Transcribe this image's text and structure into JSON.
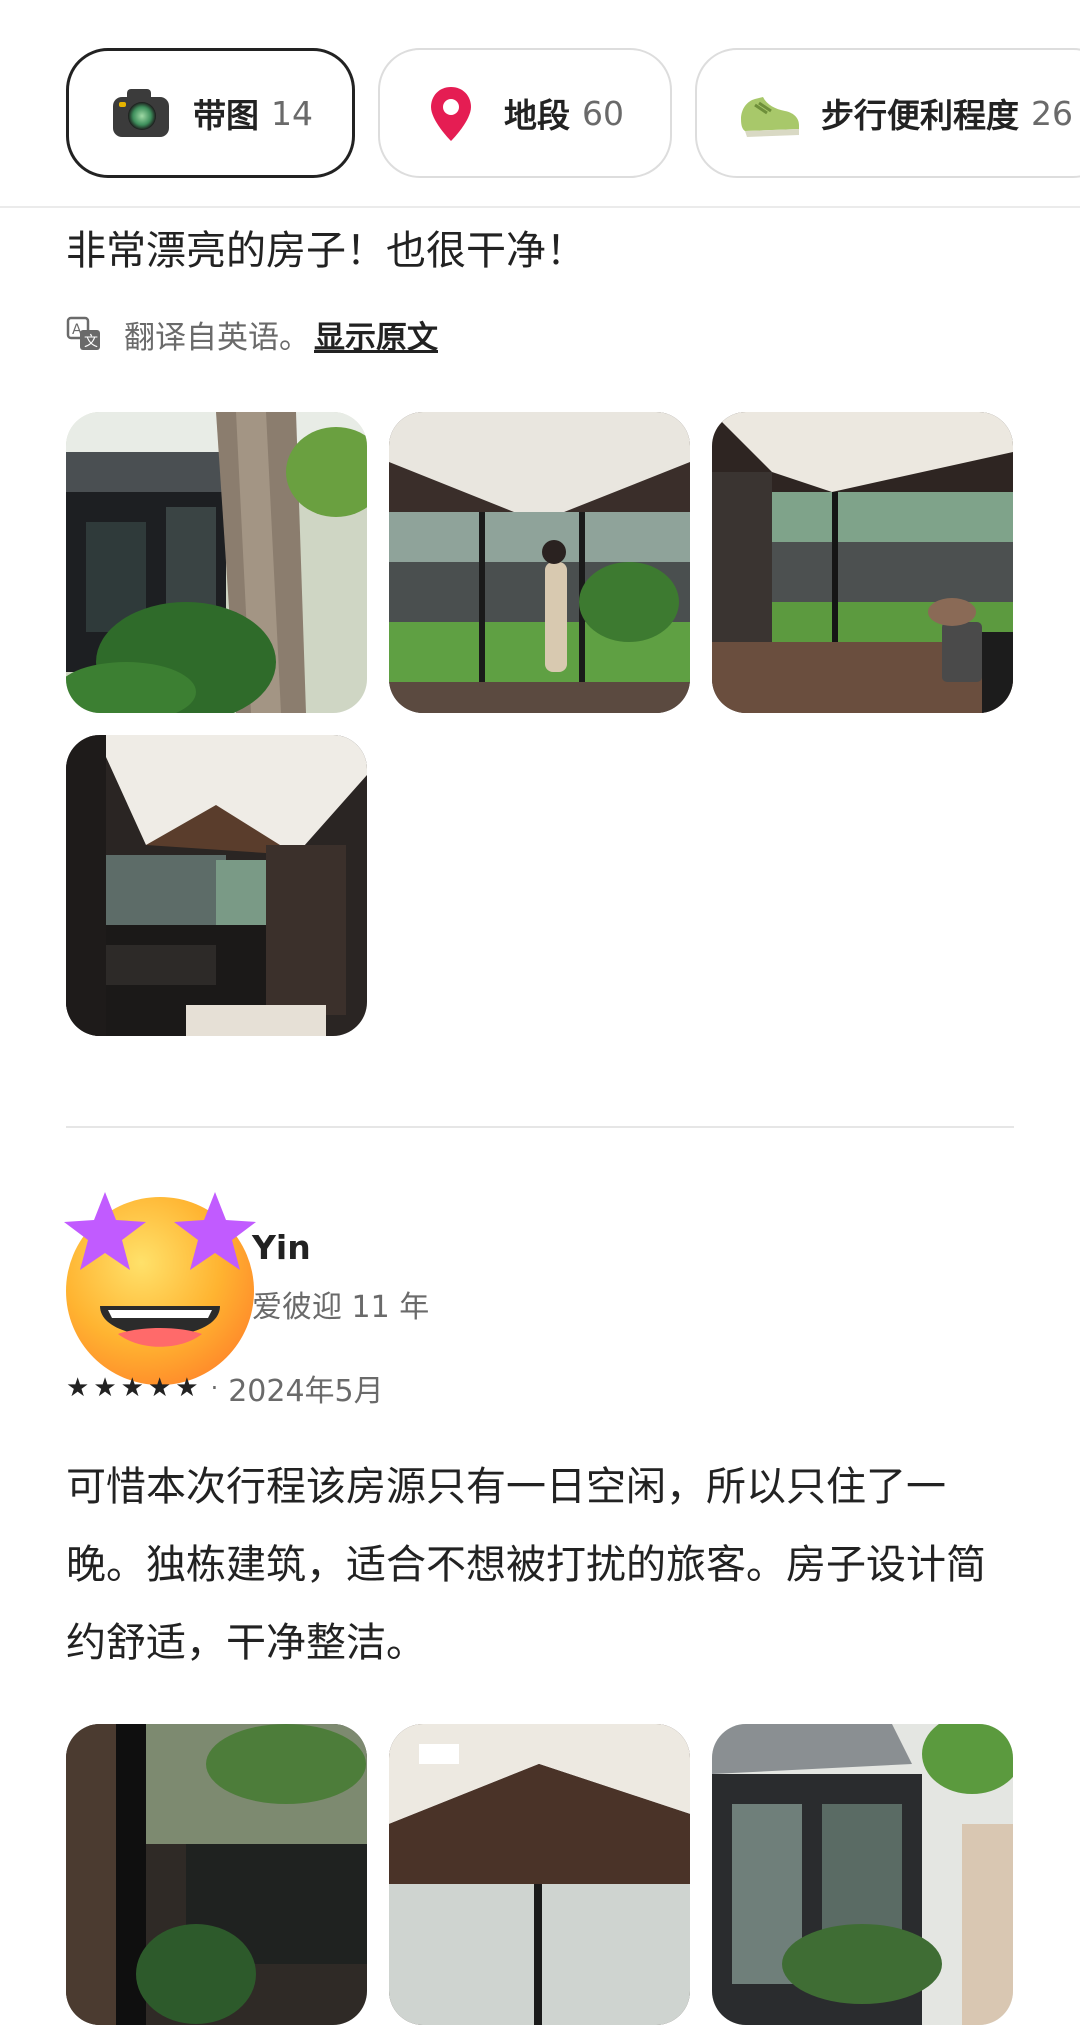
{
  "filters": [
    {
      "label": "带图",
      "count": "14",
      "icon": "camera-icon",
      "selected": true
    },
    {
      "label": "地段",
      "count": "60",
      "icon": "location-pin-icon",
      "selected": false
    },
    {
      "label": "步行便利程度",
      "count": "26",
      "icon": "shoe-icon",
      "selected": false
    }
  ],
  "review1": {
    "text": "非常漂亮的房子！也很干净！",
    "translation_note": "翻译自英语。",
    "show_original": "显示原文"
  },
  "review2": {
    "name": "Yin",
    "member_since": "爱彼迎 11 年",
    "rating": 5,
    "date": "2024年5月",
    "text": "可惜本次行程该房源只有一日空闲，所以只住了一晚。独栋建筑，适合不想被打扰的旅客。房子设计简约舒适，干净整洁。"
  },
  "colors": {
    "text": "#222222",
    "muted": "#6a6a6a",
    "chip_border": "#dddddd",
    "pin": "#e51d53"
  }
}
